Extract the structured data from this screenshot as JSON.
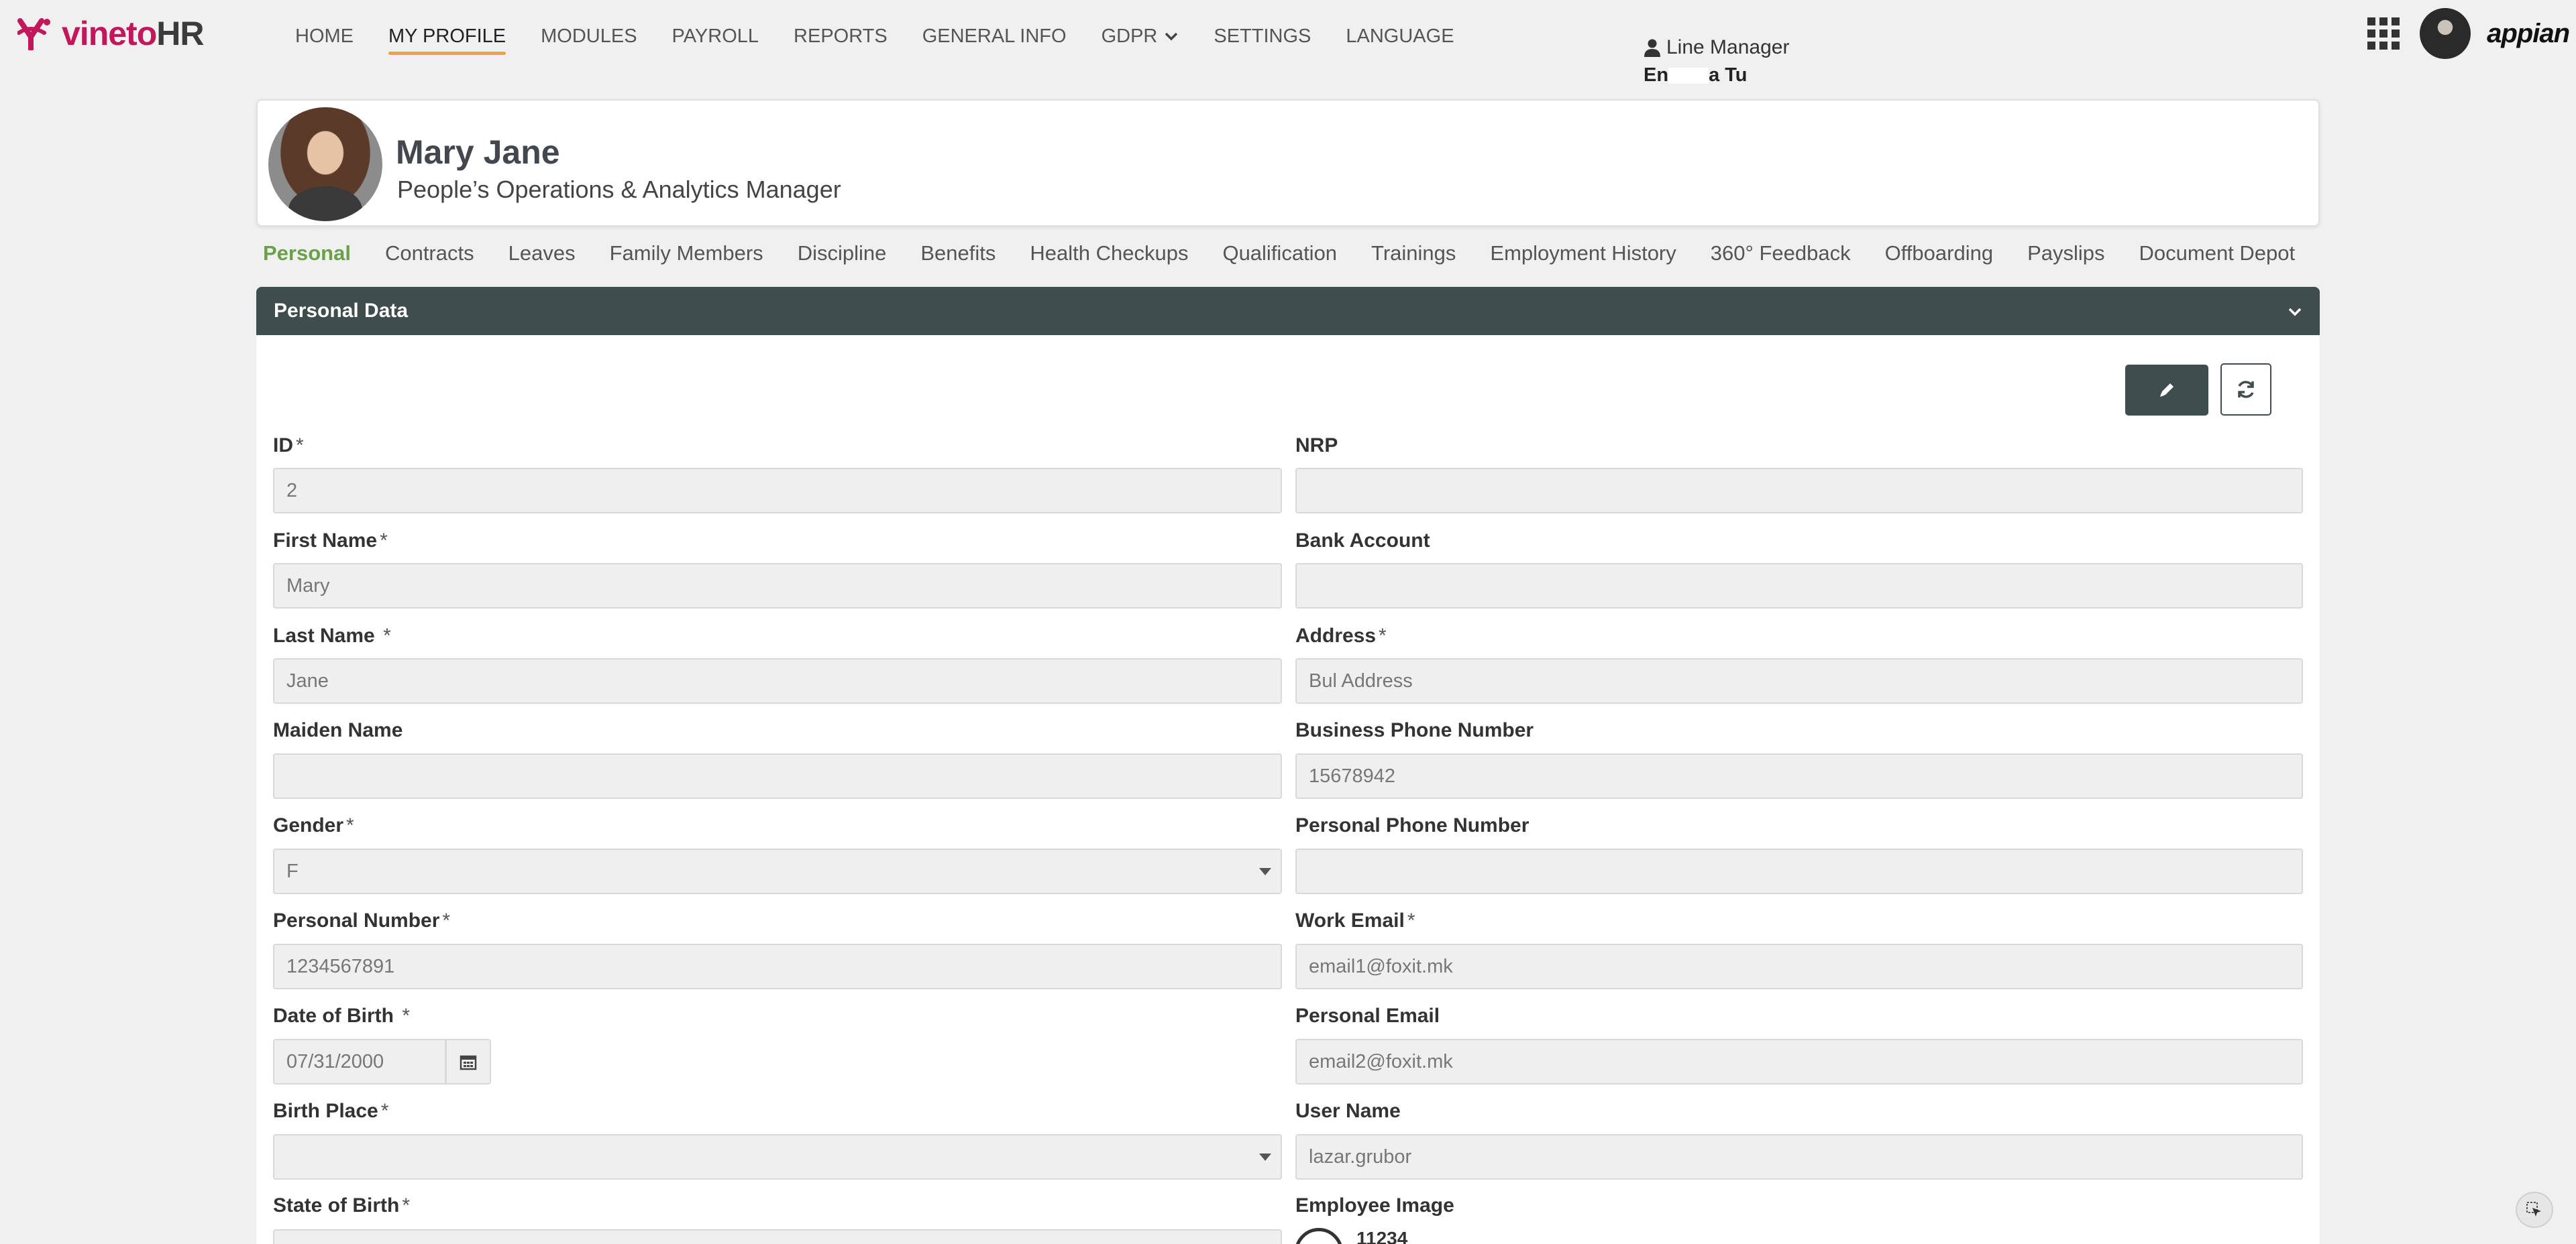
{
  "nav": {
    "logo_prefix": "vineto",
    "logo_suffix": "HR",
    "items": [
      {
        "label": "HOME"
      },
      {
        "label": "MY PROFILE"
      },
      {
        "label": "MODULES"
      },
      {
        "label": "PAYROLL"
      },
      {
        "label": "REPORTS"
      },
      {
        "label": "GENERAL INFO"
      },
      {
        "label": "GDPR"
      },
      {
        "label": "SETTINGS"
      },
      {
        "label": "LANGUAGE"
      }
    ],
    "active_item": "MY PROFILE",
    "brand_right": "appian",
    "accent_color": "#f0a33a",
    "logo_color": "#c2185b"
  },
  "profile": {
    "name": "Mary Jane",
    "title": "People’s Operations & Analytics Manager",
    "line_manager_label": "Line Manager",
    "line_manager_name_start": "En",
    "line_manager_name_mid": "a Tu"
  },
  "tabs": [
    {
      "label": "Personal"
    },
    {
      "label": "Contracts"
    },
    {
      "label": "Leaves"
    },
    {
      "label": "Family Members"
    },
    {
      "label": "Discipline"
    },
    {
      "label": "Benefits"
    },
    {
      "label": "Health Checkups"
    },
    {
      "label": "Qualification"
    },
    {
      "label": "Trainings"
    },
    {
      "label": "Employment History"
    },
    {
      "label": "360° Feedback"
    },
    {
      "label": "Offboarding"
    },
    {
      "label": "Payslips"
    },
    {
      "label": "Document Depot"
    }
  ],
  "section": {
    "title": "Personal Data",
    "header_color": "#3f4d4f"
  },
  "fields": {
    "id": {
      "label": "ID",
      "value": "2"
    },
    "nrp": {
      "label": "NRP",
      "value": ""
    },
    "first_name": {
      "label": "First Name",
      "value": "Mary"
    },
    "bank_account": {
      "label": "Bank Account",
      "value": ""
    },
    "last_name": {
      "label": "Last Name ",
      "value": "Jane"
    },
    "address": {
      "label": "Address",
      "value": "Bul Address"
    },
    "maiden_name": {
      "label": "Maiden Name",
      "value": ""
    },
    "business_phone": {
      "label": "Business Phone Number",
      "value": "15678942"
    },
    "gender": {
      "label": "Gender",
      "value": "F"
    },
    "personal_phone": {
      "label": "Personal Phone Number",
      "value": ""
    },
    "personal_number": {
      "label": "Personal Number",
      "value": "1234567891"
    },
    "work_email": {
      "label": "Work Email",
      "value": "email1@foxit.mk"
    },
    "dob": {
      "label": "Date of Birth ",
      "value": "07/31/2000"
    },
    "personal_email": {
      "label": "Personal Email",
      "value": "email2@foxit.mk"
    },
    "birth_place": {
      "label": "Birth Place",
      "value": ""
    },
    "user_name": {
      "label": "User Name",
      "value": "lazar.grubor"
    },
    "state_of_birth": {
      "label": "State of Birth",
      "value": ""
    },
    "employee_image": {
      "label": "Employee Image",
      "value": "11234"
    },
    "required_marker": "*"
  }
}
